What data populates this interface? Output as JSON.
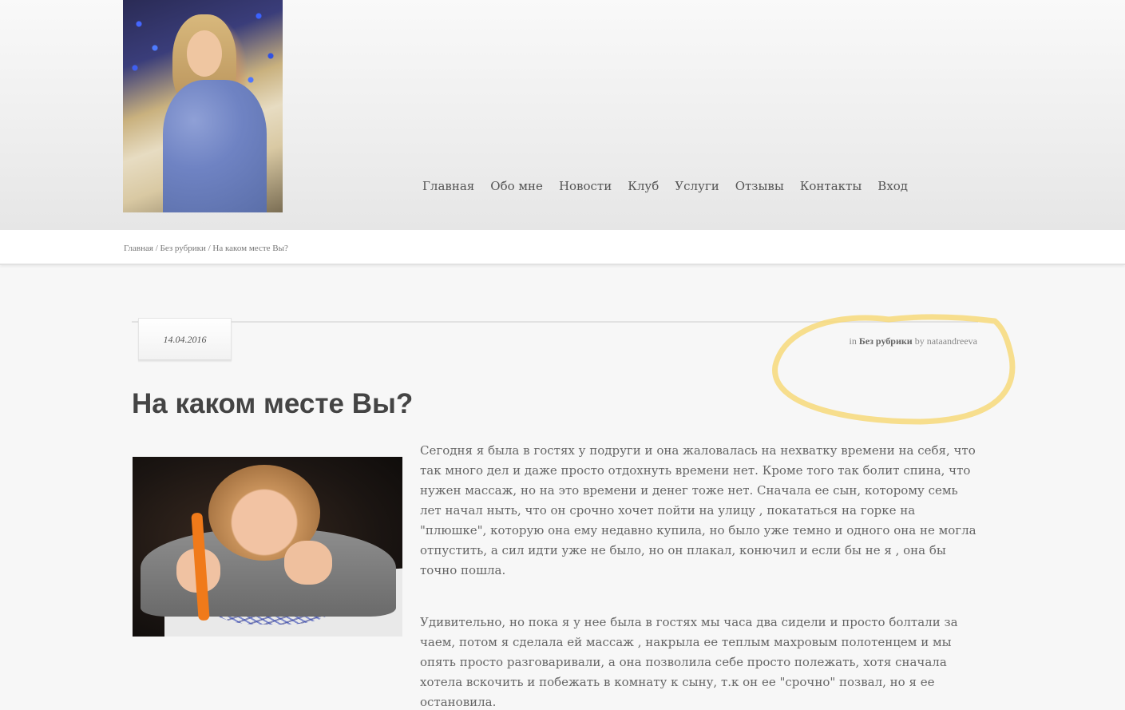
{
  "header": {
    "nav": [
      "Главная",
      "Обо мне",
      "Новости",
      "Клуб",
      "Услуги",
      "Отзывы",
      "Контакты",
      "Вход"
    ]
  },
  "breadcrumb": {
    "home": "Главная",
    "sep1": " / ",
    "category": "Без рубрики",
    "sep2": " / ",
    "current": "На каком месте Вы?"
  },
  "post": {
    "date": "14.04.2016",
    "byline_in": "in ",
    "category": "Без рубрики",
    "byline_by": " by ",
    "author": "nataandreeva",
    "title": "На каком месте Вы?",
    "paragraphs": [
      "Сегодня я была в гостях у подруги и она жаловалась на нехватку времени на себя, что так много дел и даже просто отдохнуть времени нет. Кроме того так болит спина, что нужен массаж, но на это времени и денег тоже нет. Сначала ее сын, которому семь лет начал ныть, что он срочно хочет пойти на улицу , покататься на горке на \"плюшке\", которую она ему недавно купила, но было уже темно и одного она не могла отпустить, а сил идти уже не было, но он плакал, конючил и если бы не я , она бы точно пошла.",
      "Удивительно, но пока я у нее была в гостях мы часа два сидели и просто болтали за чаем, потом я сделала ей массаж , накрыла ее теплым махровым полотенцем и мы опять просто разговаривали, а она позволила себе просто полежать, хотя сначала хотела вскочить и побежать в комнату к сыну, т.к он ее \"срочно\" позвал, но я ее остановила."
    ]
  },
  "colors": {
    "highlight": "#f7d97a"
  }
}
